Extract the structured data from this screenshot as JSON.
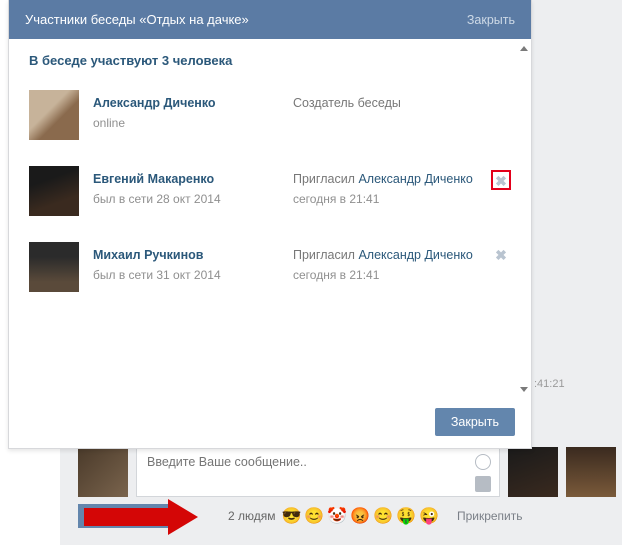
{
  "dialog": {
    "title": "Участники беседы «Отдых на дачке»",
    "close_top": "Закрыть",
    "subtitle": "В беседе участвуют 3 человека",
    "footer_close": "Закрыть"
  },
  "members": [
    {
      "name": "Александр Диченко",
      "status": "online",
      "role": "Создатель беседы",
      "invite_by": "",
      "invite_time": ""
    },
    {
      "name": "Евгений Макаренко",
      "status": "был в сети 28 окт 2014",
      "invite_label": "Пригласил ",
      "invite_by": "Александр Диченко",
      "invite_time": "сегодня в 21:41"
    },
    {
      "name": "Михаил Ручкинов",
      "status": "был в сети 31 окт 2014",
      "invite_label": "Пригласил ",
      "invite_by": "Александр Диченко",
      "invite_time": "сегодня в 21:41"
    }
  ],
  "bg": {
    "timestamp": ":41:21"
  },
  "compose": {
    "placeholder": "Введите Ваше сообщение..",
    "people": "2 людям",
    "attach": "Прикрепить",
    "emojis": [
      "😎",
      "😊",
      "🤡",
      "😡",
      "😊",
      "🤑",
      "😜"
    ]
  }
}
